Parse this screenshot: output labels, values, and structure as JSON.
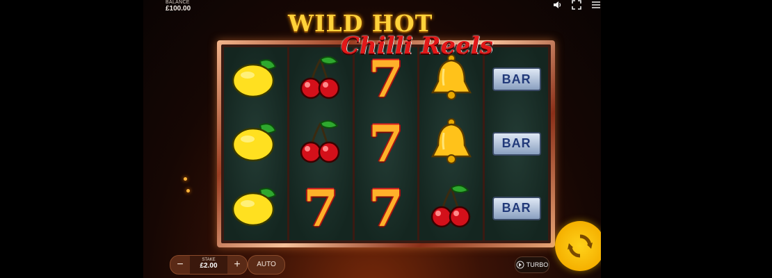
{
  "balance": {
    "label": "BALANCE",
    "value": "£100.00"
  },
  "top_icons": [
    "speaker-icon",
    "fullscreen-icon",
    "menu-icon"
  ],
  "logo": {
    "line1": "WILD HOT",
    "line2": "Chilli Reels"
  },
  "reels": [
    [
      "lemon",
      "lemon",
      "lemon"
    ],
    [
      "cherries",
      "cherries",
      "seven"
    ],
    [
      "seven",
      "seven",
      "seven"
    ],
    [
      "bell",
      "bell",
      "cherries"
    ],
    [
      "bar",
      "bar",
      "bar"
    ]
  ],
  "symbol_text": {
    "seven": "7",
    "bar": "BAR"
  },
  "controls": {
    "minus": "−",
    "plus": "+",
    "stake_label": "STAKE",
    "stake_value": "£2.00",
    "auto_label": "AUTO",
    "turbo_label": "TURBO"
  },
  "colors": {
    "accent": "#ffd21a",
    "panel": "#5a2a16",
    "background": "#160704"
  }
}
